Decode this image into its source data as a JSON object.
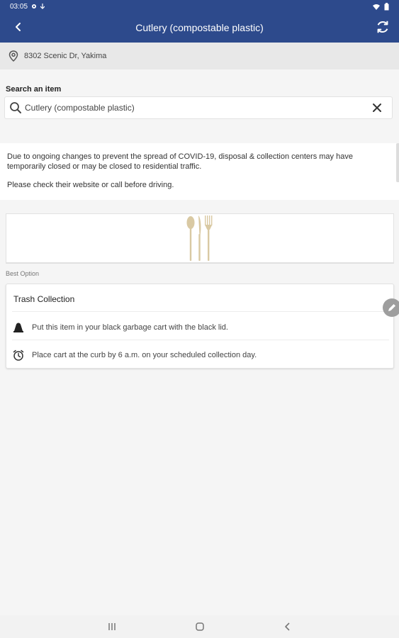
{
  "status_bar": {
    "time": "03:05",
    "icons": [
      "settings-icon",
      "download-icon",
      "wifi-icon",
      "battery-icon"
    ]
  },
  "app_bar": {
    "title": "Cutlery (compostable plastic)",
    "back_icon": "back-chevron-icon",
    "refresh_icon": "refresh-icon",
    "color": "#2d4a8c"
  },
  "location": {
    "icon": "location-pin-icon",
    "address": "8302 Scenic Dr, Yakima"
  },
  "search": {
    "label": "Search an item",
    "value": "Cutlery (compostable plastic)",
    "placeholder": "Search an item",
    "search_icon": "search-icon",
    "clear_icon": "close-icon"
  },
  "notice": {
    "line1": "Due to ongoing changes to prevent the spread of COVID-19, disposal & collection centers may have temporarily closed or may be closed to residential traffic.",
    "line2": "Please check their website or call before driving."
  },
  "item_image": {
    "icon": "cutlery-icon"
  },
  "best_option": {
    "label": "Best Option",
    "title": "Trash Collection",
    "rows": [
      {
        "icon": "garbage-cart-icon",
        "text": "Put this item in your black garbage cart with the black lid."
      },
      {
        "icon": "alarm-clock-icon",
        "text": "Place cart at the curb by 6 a.m. on your scheduled collection day."
      }
    ]
  },
  "edit_fab": {
    "icon": "pencil-icon"
  },
  "nav_bar": {
    "icons": [
      "recent-apps-icon",
      "home-icon",
      "back-icon"
    ]
  }
}
